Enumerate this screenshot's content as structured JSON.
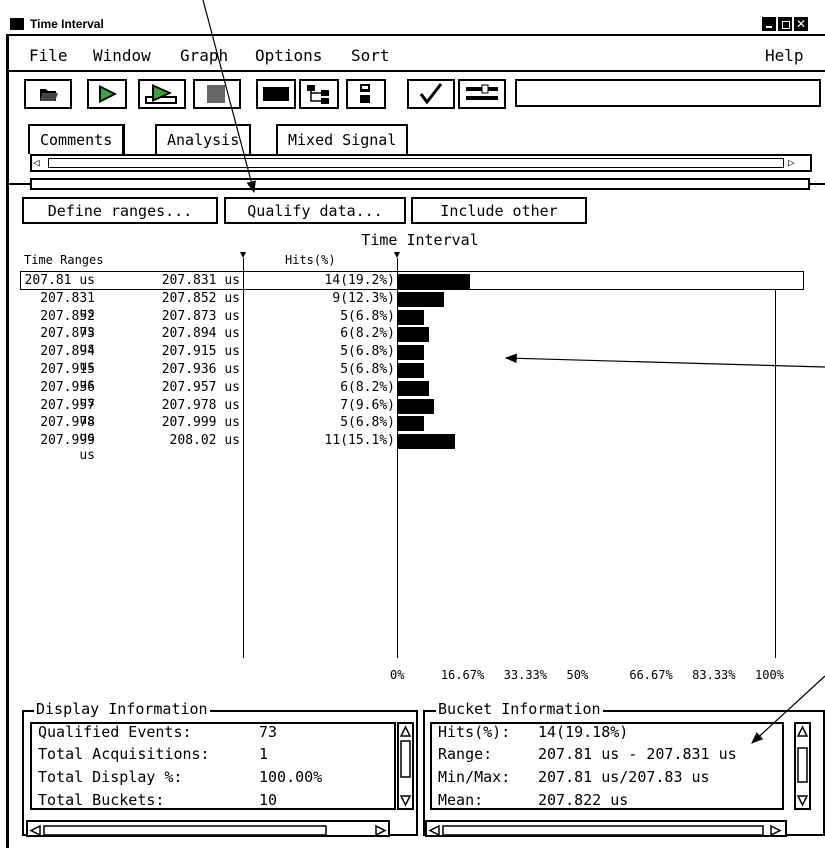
{
  "window": {
    "title": "Time Interval"
  },
  "menu": {
    "file": "File",
    "window": "Window",
    "graph": "Graph",
    "options": "Options",
    "sort": "Sort",
    "help": "Help"
  },
  "toolbar": {
    "icons": [
      "open-folder-icon",
      "run-icon",
      "run-repetitive-icon",
      "stop-icon",
      "black-rectangle-icon",
      "hierarchy-icon",
      "module-icon",
      "checkmark-icon",
      "tool-icon"
    ],
    "field_value": ""
  },
  "tabs": [
    {
      "label": "Comments",
      "active": true
    },
    {
      "label": "Analysis",
      "active": false
    },
    {
      "label": "Mixed Signal",
      "active": false
    }
  ],
  "actions": {
    "define": "Define ranges...",
    "qualify": "Qualify data...",
    "include": "Include other"
  },
  "histogram": {
    "title": "Time Interval",
    "col_ranges": "Time Ranges",
    "col_hits": "Hits(%)",
    "rows": [
      {
        "start": "207.81 us",
        "end": "207.831 us",
        "hits": "14(19.2%)",
        "pct": 19.2
      },
      {
        "start": "207.831 us",
        "end": "207.852 us",
        "hits": "9(12.3%)",
        "pct": 12.3
      },
      {
        "start": "207.852 us",
        "end": "207.873 us",
        "hits": "5(6.8%)",
        "pct": 6.8
      },
      {
        "start": "207.873 us",
        "end": "207.894 us",
        "hits": "6(8.2%)",
        "pct": 8.2
      },
      {
        "start": "207.894 us",
        "end": "207.915 us",
        "hits": "5(6.8%)",
        "pct": 6.8
      },
      {
        "start": "207.915 us",
        "end": "207.936 us",
        "hits": "5(6.8%)",
        "pct": 6.8
      },
      {
        "start": "207.936 us",
        "end": "207.957 us",
        "hits": "6(8.2%)",
        "pct": 8.2
      },
      {
        "start": "207.957 us",
        "end": "207.978 us",
        "hits": "7(9.6%)",
        "pct": 9.6
      },
      {
        "start": "207.978 us",
        "end": "207.999 us",
        "hits": "5(6.8%)",
        "pct": 6.8
      },
      {
        "start": "207.999 us",
        "end": "208.02 us",
        "hits": "11(15.1%)",
        "pct": 15.1
      }
    ],
    "x_ticks": [
      "0%",
      "16.67%",
      "33.33%",
      "50%",
      "66.67%",
      "83.33%",
      "100%"
    ],
    "x_max_pct": 100
  },
  "display_info": {
    "title": "Display Information",
    "lines": [
      {
        "label": "Qualified Events:",
        "value": "73"
      },
      {
        "label": "Total Acquisitions:",
        "value": "1"
      },
      {
        "label": "Total Display %:",
        "value": "100.00%"
      },
      {
        "label": "Total Buckets:",
        "value": "10"
      }
    ]
  },
  "bucket_info": {
    "title": "Bucket Information",
    "lines": [
      {
        "label": "Hits(%):",
        "value": "14(19.18%)"
      },
      {
        "label": "Range:",
        "value": "207.81 us - 207.831 us"
      },
      {
        "label": "Min/Max:",
        "value": "207.81 us/207.83 us"
      },
      {
        "label": "Mean:",
        "value": "207.822 us"
      }
    ]
  }
}
